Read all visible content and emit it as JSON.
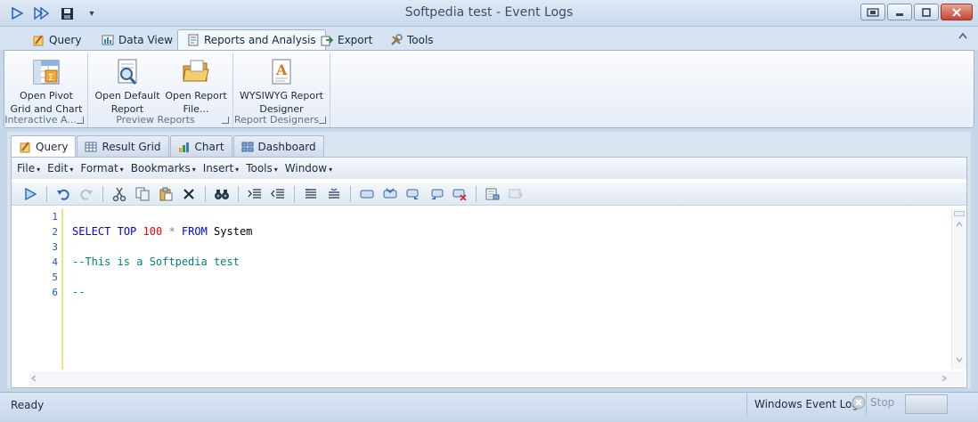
{
  "window": {
    "title": "Softpedia test - Event Logs",
    "qat_customize": "▾"
  },
  "ribbon": {
    "tabs": [
      {
        "label": "Query",
        "icon": "query-pencil-icon"
      },
      {
        "label": "Data View",
        "icon": "data-view-icon"
      },
      {
        "label": "Reports and Analysis",
        "icon": "report-icon"
      },
      {
        "label": "Export",
        "icon": "export-icon"
      },
      {
        "label": "Tools",
        "icon": "tools-icon"
      }
    ],
    "groups": [
      {
        "label": "Interactive A...",
        "buttons": [
          {
            "label_line1": "Open Pivot",
            "label_line2": "Grid and Chart",
            "icon": "pivot-grid-icon"
          }
        ]
      },
      {
        "label": "Preview Reports",
        "buttons": [
          {
            "label_line1": "Open Default",
            "label_line2": "Report",
            "icon": "magnifier-report-icon"
          },
          {
            "label_line1": "Open Report",
            "label_line2": "File...",
            "icon": "folder-open-icon"
          }
        ]
      },
      {
        "label": "Report Designers",
        "buttons": [
          {
            "label_line1": "WYSIWYG Report",
            "label_line2": "Designer",
            "icon": "report-designer-icon"
          }
        ]
      }
    ]
  },
  "doc_tabs": [
    {
      "label": "Query",
      "icon": "query-pencil-icon"
    },
    {
      "label": "Result Grid",
      "icon": "grid-icon"
    },
    {
      "label": "Chart",
      "icon": "chart-icon"
    },
    {
      "label": "Dashboard",
      "icon": "dashboard-icon"
    }
  ],
  "menu": [
    "File",
    "Edit",
    "Format",
    "Bookmarks",
    "Insert",
    "Tools",
    "Window"
  ],
  "menu_arrow": "▾",
  "editor": {
    "line_numbers": [
      "1",
      "2",
      "3",
      "4",
      "5",
      "6"
    ],
    "line2": {
      "kw1": "SELECT",
      "kw2": "TOP",
      "num": "100",
      "op": "*",
      "kw3": "FROM",
      "ident": "System"
    },
    "line4": "--This is a Softpedia test",
    "line6": "--"
  },
  "status": {
    "left": "Ready",
    "source": "Windows Event Log",
    "stop": "Stop"
  },
  "colors": {
    "keyword": "#0000ff",
    "number": "#ff0000",
    "comment": "#008080",
    "line_number": "#2b57a8"
  }
}
